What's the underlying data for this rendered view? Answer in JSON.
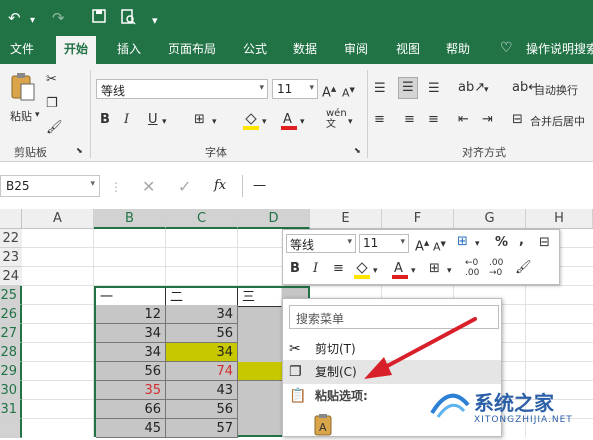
{
  "quick_access": {
    "undo": "↶",
    "redo": "↷",
    "save": "💾",
    "preview": "🔍",
    "more": "▾"
  },
  "tabs": [
    "文件",
    "开始",
    "插入",
    "页面布局",
    "公式",
    "数据",
    "审阅",
    "视图",
    "帮助",
    "操作说明搜索"
  ],
  "ribbon": {
    "paste_label": "粘贴",
    "clipboard_label": "剪贴板",
    "font_name": "等线",
    "font_size": "11",
    "font_group_label": "字体",
    "wrap_text": "自动换行",
    "merge_center": "合并后居中",
    "align_group_label": "对齐方式"
  },
  "formula_bar": {
    "name_box": "B25",
    "fx": "fx",
    "value": "—"
  },
  "columns": [
    "A",
    "B",
    "C",
    "D",
    "E",
    "F",
    "G",
    "H"
  ],
  "rows": [
    "22",
    "23",
    "24",
    "25",
    "26",
    "27",
    "28",
    "29",
    "30",
    "31"
  ],
  "cells": {
    "B25": "一",
    "C25": "二",
    "D25": "三",
    "B26": "12",
    "C26": "34",
    "B27": "34",
    "C27": "56",
    "B28": "34",
    "C28": "34",
    "B29": "56",
    "C29": "74",
    "B30": "35",
    "C30": "43",
    "B31": "66",
    "C31": "56",
    "B32": "45",
    "C32": "57"
  },
  "mini_toolbar": {
    "font_name": "等线",
    "font_size": "11"
  },
  "context_menu": {
    "search_placeholder": "搜索菜单",
    "items": [
      "剪切(T)",
      "复制(C)",
      "粘贴选项:"
    ]
  },
  "watermark": {
    "name": "系统之家",
    "url": "XITONGZHIJIA.NET"
  },
  "colors": {
    "accent": "#217346",
    "yellow": "#c8c800",
    "red_text": "#d22e2e",
    "arrow": "#d8202a"
  }
}
